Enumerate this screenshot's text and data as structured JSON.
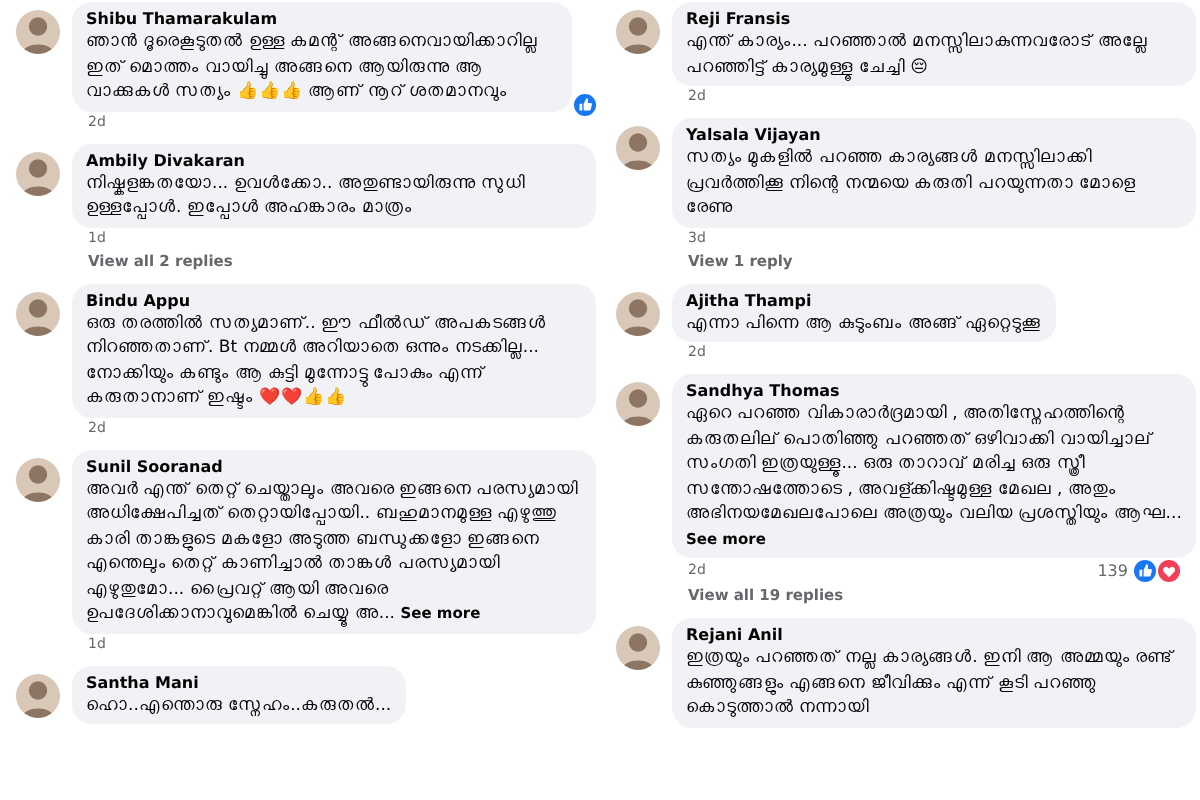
{
  "columns": [
    {
      "comments": [
        {
          "name": "Shibu Thamarakulam",
          "text": "ഞാൻ ദൂരെകൂടുതൽ ഉള്ള കമന്റ് അങ്ങനെവായിക്കാറില്ല ഇത് മൊത്തം വായിച്ചു അങ്ങനെ ആയിരുന്നു ആ വാക്കുകൾ സത്യം 👍👍👍 ആണ് നൂറ് ശതമാനവും",
          "time": "2d",
          "reactions": {
            "like": true
          }
        },
        {
          "name": "Ambily Divakaran",
          "text": "നിഷ്കളങ്കതയോ... ഉവൾക്കോ.. അതുണ്ടായിരുന്നു സുധി ഉള്ളപ്പോൾ. ഇപ്പോൾ അഹങ്കാരം മാത്രം",
          "time": "1d",
          "replies": "View all 2 replies"
        },
        {
          "name": "Bindu Appu",
          "text": "ഒരു തരത്തിൽ സത്യമാണ്.. ഈ ഫീൽഡ് അപകടങ്ങൾ നിറഞ്ഞതാണ്. Bt നമ്മൾ അറിയാതെ ഒന്നും നടക്കില്ല... നോക്കിയും കണ്ടും ആ കുട്ടി മുന്നോട്ടു പോകും എന്ന് കരുതാനാണ് ഇഷ്ടം ❤️❤️👍👍",
          "time": "2d"
        },
        {
          "name": "Sunil Sooranad",
          "text": "അവർ എന്ത് തെറ്റ് ചെയ്താലും അവരെ ഇങ്ങനെ പരസ്യമായി അധിക്ഷേപിച്ചത് തെറ്റായിപ്പോയി.. ബഹുമാനമുള്ള എഴുത്തു കാരി താങ്കളുടെ മകളോ അടുത്ത ബന്ധുക്കളോ ഇങ്ങനെ എന്തെലും തെറ്റ് കാണിച്ചാൽ താങ്കൾ പരസ്യമായി എഴുതുമോ... പ്രൈവറ്റ് ആയി അവരെ ഉപദേശിക്കാനാവുമെങ്കിൽ ചെയ്യൂ അ...",
          "see_more": "See more",
          "time": "1d"
        },
        {
          "name": "Santha Mani",
          "text": "ഹൊ..എന്തൊരു സ്നേഹം..കരുതൽ..."
        }
      ]
    },
    {
      "comments": [
        {
          "name": "Reji Fransis",
          "text": "എന്ത് കാര്യം... പറഞ്ഞാൽ മനസ്സിലാകുന്നവരോട് അല്ലേ പറഞ്ഞിട്ട് കാര്യമുള്ളൂ ചേച്ചി 😔",
          "time": "2d"
        },
        {
          "name": "Yalsala Vijayan",
          "text": "സത്യം മുകളിൽ പറഞ്ഞ കാര്യങ്ങൾ മനസ്സിലാക്കി പ്രവർത്തിക്കൂ നിന്റെ നന്മയെ കരുതി പറയുന്നതാ മോളെ രേണു",
          "time": "3d",
          "replies": "View 1 reply"
        },
        {
          "name": "Ajitha Thampi",
          "text": "എന്നാ പിന്നെ ആ കുടുംബം അങ്ങ് ഏറ്റെടുക്കൂ",
          "time": "2d"
        },
        {
          "name": "Sandhya Thomas",
          "text": "ഏറെ പറഞ്ഞ വികാരാർദ്രമായി , അതിസ്നേഹത്തിന്റെ കരുതലില് പൊതിഞ്ഞു പറഞ്ഞത് ഒഴിവാക്കി വായിച്ചാല് സംഗതി ഇത്രയുള്ളൂ... ഒരു താറാവ് മരിച്ച ഒരു സ്ത്രീ സന്തോഷത്തോടെ , അവള്ക്കിഷ്ടമുള്ള മേഖല , അതും അഭിനയമേഖലപോലെ അത്രയും വലിയ പ്രശസ്തിയും ആഘ...",
          "see_more": "See more",
          "time": "2d",
          "reactions": {
            "count": "139",
            "like": true,
            "love": true
          },
          "replies": "View all 19 replies"
        },
        {
          "name": "Rejani Anil",
          "text": "ഇത്രയും പറഞ്ഞത് നല്ല കാര്യങ്ങൾ. ഇനി ആ അമ്മയും രണ്ട് കുഞ്ഞുങ്ങളും എങ്ങനെ ജീവിക്കും എന്ന് കൂടി പറഞ്ഞു കൊടുത്താൽ നന്നായി"
        }
      ]
    }
  ]
}
